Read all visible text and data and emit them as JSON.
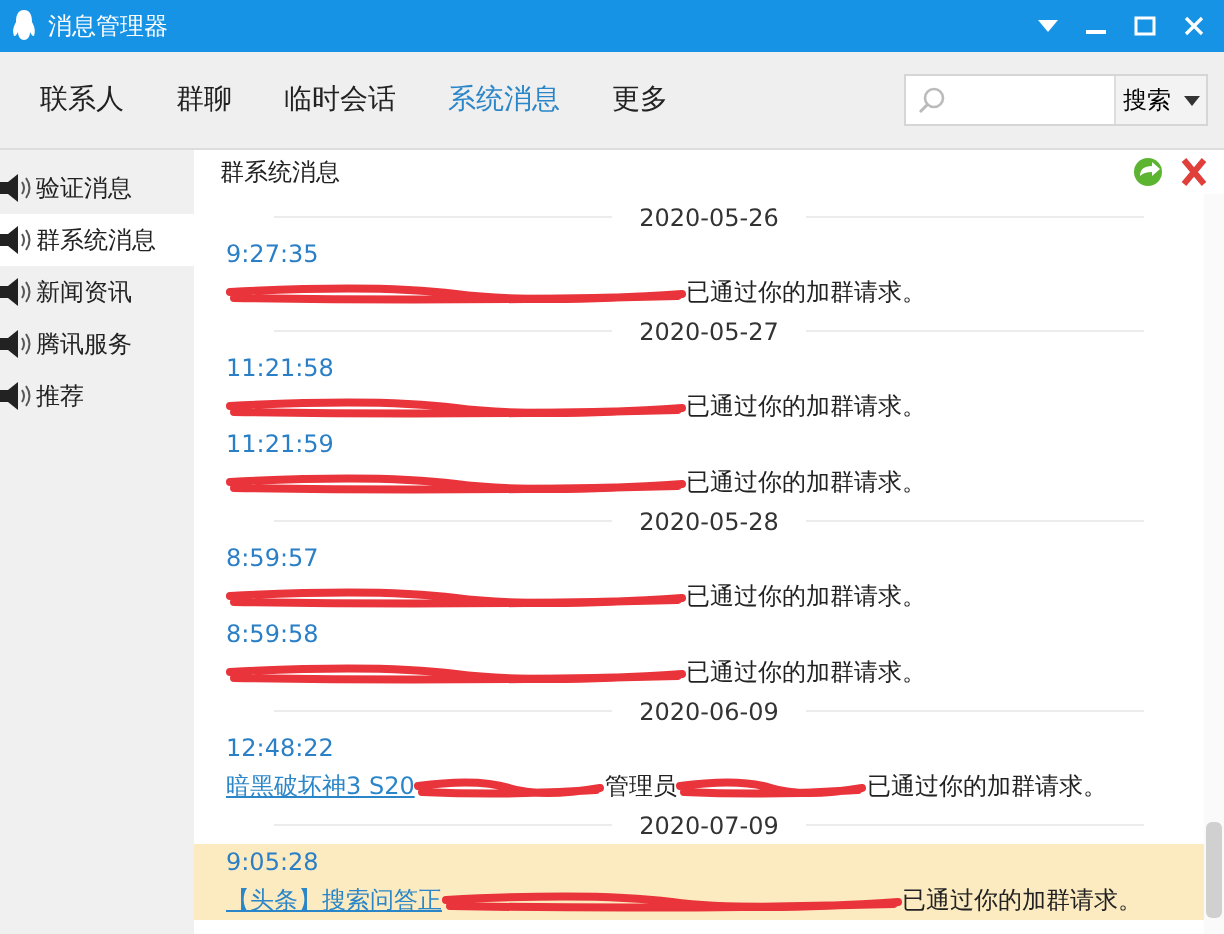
{
  "window": {
    "title": "消息管理器"
  },
  "tabs": [
    {
      "label": "联系人",
      "selected": false
    },
    {
      "label": "群聊",
      "selected": false
    },
    {
      "label": "临时会话",
      "selected": false
    },
    {
      "label": "系统消息",
      "selected": true
    },
    {
      "label": "更多",
      "selected": false
    }
  ],
  "search": {
    "button": "搜索"
  },
  "sidebar": {
    "items": [
      {
        "label": "验证消息",
        "selected": false
      },
      {
        "label": "群系统消息",
        "selected": true
      },
      {
        "label": "新闻资讯",
        "selected": false
      },
      {
        "label": "腾讯服务",
        "selected": false
      },
      {
        "label": "推荐",
        "selected": false
      }
    ]
  },
  "panel": {
    "title": "群系统消息"
  },
  "messages": [
    {
      "date": "2020-05-26",
      "time": "9:27:35",
      "selected": false,
      "parts": [
        {
          "kind": "redacted"
        },
        {
          "kind": "text",
          "text": "已通过你的加群请求。"
        }
      ]
    },
    {
      "date": "2020-05-27",
      "time": "11:21:58",
      "selected": false,
      "parts": [
        {
          "kind": "redacted"
        },
        {
          "kind": "text",
          "text": "已通过你的加群请求。"
        }
      ]
    },
    {
      "time": "11:21:59",
      "selected": false,
      "parts": [
        {
          "kind": "redacted"
        },
        {
          "kind": "text",
          "text": "已通过你的加群请求。"
        }
      ]
    },
    {
      "date": "2020-05-28",
      "time": "8:59:57",
      "selected": false,
      "parts": [
        {
          "kind": "redacted"
        },
        {
          "kind": "text",
          "text": "已通过你的加群请求。"
        }
      ]
    },
    {
      "time": "8:59:58",
      "selected": false,
      "parts": [
        {
          "kind": "redacted"
        },
        {
          "kind": "text",
          "text": "已通过你的加群请求。"
        }
      ]
    },
    {
      "date": "2020-06-09",
      "time": "12:48:22",
      "selected": false,
      "parts": [
        {
          "kind": "link",
          "text": "暗黑破坏神3 S20"
        },
        {
          "kind": "redacted"
        },
        {
          "kind": "text",
          "text": "管理员"
        },
        {
          "kind": "redacted"
        },
        {
          "kind": "text",
          "text": "已通过你的加群请求。"
        }
      ]
    },
    {
      "date": "2020-07-09",
      "time": "9:05:28",
      "selected": true,
      "parts": [
        {
          "kind": "link",
          "text": "【头条】搜索问答正"
        },
        {
          "kind": "redacted"
        },
        {
          "kind": "text",
          "text": "已通过你的加群请求。"
        }
      ]
    }
  ]
}
